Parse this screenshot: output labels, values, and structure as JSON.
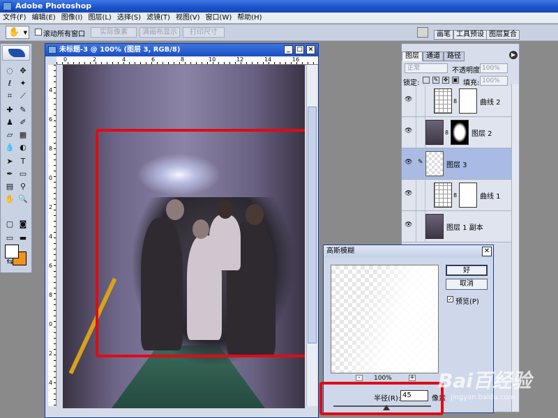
{
  "app": {
    "title": "Adobe Photoshop"
  },
  "menu": [
    "文件(F)",
    "编辑(E)",
    "图像(I)",
    "图层(L)",
    "选择(S)",
    "滤镜(T)",
    "视图(V)",
    "窗口(W)",
    "帮助(H)"
  ],
  "options": {
    "scroll_all_label": "滚动所有窗口",
    "actual_pixels": "实际像素",
    "fit_screen": "满画布显示",
    "print_size": "打印尺寸"
  },
  "palette_well": {
    "tabs": [
      "画笔",
      "工具预设",
      "图层复合"
    ]
  },
  "document": {
    "title": "未标题-3 @ 100% (图层 3, RGB/8)",
    "ruler_top": [
      "0",
      "2",
      "4",
      "6",
      "8",
      "10",
      "12",
      "14",
      "16"
    ],
    "ruler_left": [
      "4",
      "6",
      "8",
      "0",
      "2",
      "4",
      "6",
      "8",
      "0",
      "2",
      "4"
    ]
  },
  "layers_panel": {
    "tabs": [
      "图层",
      "通道",
      "路径"
    ],
    "blend_mode": "正常",
    "opacity_label": "不透明度:",
    "opacity_value": "100%",
    "lock_label": "锁定:",
    "fill_label": "填充:",
    "fill_value": "100%",
    "layers": [
      {
        "name": "曲线 2",
        "kind": "curves"
      },
      {
        "name": "图层 2",
        "kind": "masked"
      },
      {
        "name": "图层 3",
        "kind": "transparent",
        "selected": true
      },
      {
        "name": "曲线 1",
        "kind": "curves"
      },
      {
        "name": "图层 1 副本",
        "kind": "image"
      }
    ]
  },
  "dialog": {
    "title": "高斯模糊",
    "ok": "好",
    "cancel": "取消",
    "preview_label": "预览(P)",
    "zoom": "100%",
    "radius_label": "半径(R):",
    "radius_value": "45",
    "radius_unit": "像素"
  },
  "watermark": {
    "brand": "Bai百经验",
    "url": "jingyan.baidu.com"
  },
  "colors": {
    "selection_red": "#e00b14",
    "bg_swatch": "#f0921e",
    "fg_swatch": "#ffffff"
  }
}
